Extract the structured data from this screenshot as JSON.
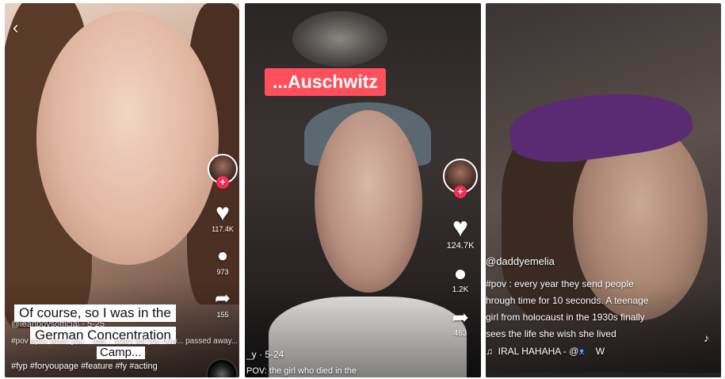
{
  "panels": [
    {
      "caption_lines": [
        "Of course, so I was in the",
        "German Concentration",
        "Camp..."
      ],
      "likes": "117.4K",
      "comments": "973",
      "shares": "155",
      "username": "@leahpovsofficial · 5-25",
      "desc": "#pov #pov when you... feel... scars tell you how... passed away...",
      "hashtags": "#fyp #foryoupage #feature #fy #acting"
    },
    {
      "chip": "...Auschwitz",
      "likes": "124.7K",
      "comments": "1.2K",
      "shares": "463",
      "username": "_y · 5-24",
      "desc": "POV: the girl who died in the"
    },
    {
      "username": "@daddyemelia",
      "desc_lines": [
        "#pov : every year they send people",
        "hrough time for 10 seconds. A teenage",
        "girl from holocaust in the 1930s finally",
        "sees the life she wish she lived"
      ],
      "sound": "IRAL HAHAHA - @",
      "sound_tail": "W"
    }
  ],
  "icons": {
    "back": "back-arrow-icon",
    "heart": "heart-icon",
    "comment": "comment-icon",
    "share": "share-icon",
    "music": "music-note-icon",
    "butterfly": "butterfly-icon"
  }
}
